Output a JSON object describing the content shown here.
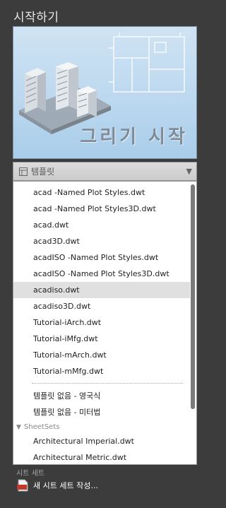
{
  "panel": {
    "title": "시작하기"
  },
  "start_drawing": {
    "label": "그리기 시작"
  },
  "templates": {
    "header": "템플릿",
    "items": [
      "acad -Named Plot Styles.dwt",
      "acad -Named Plot Styles3D.dwt",
      "acad.dwt",
      "acad3D.dwt",
      "acadISO -Named Plot Styles.dwt",
      "acadISO -Named Plot Styles3D.dwt",
      "acadiso.dwt",
      "acadiso3D.dwt",
      "Tutorial-iArch.dwt",
      "Tutorial-iMfg.dwt",
      "Tutorial-mArch.dwt",
      "Tutorial-mMfg.dwt"
    ],
    "selected_index": 6,
    "no_template_items": [
      "템플릿 없음 - 영국식",
      "템플릿 없음 - 미터법"
    ]
  },
  "sheetsets": {
    "header": "SheetSets",
    "items": [
      "Architectural Imperial.dwt",
      "Architectural Metric.dwt"
    ]
  },
  "footer": {
    "label": "시트 세트",
    "new_sheet_set": "새 시트 세트 작성...",
    "icon_text": "DST"
  },
  "colors": {
    "background": "#3c3c3c",
    "selected_row": "#e0e0e0",
    "tile_accent": "#a9cdea"
  }
}
